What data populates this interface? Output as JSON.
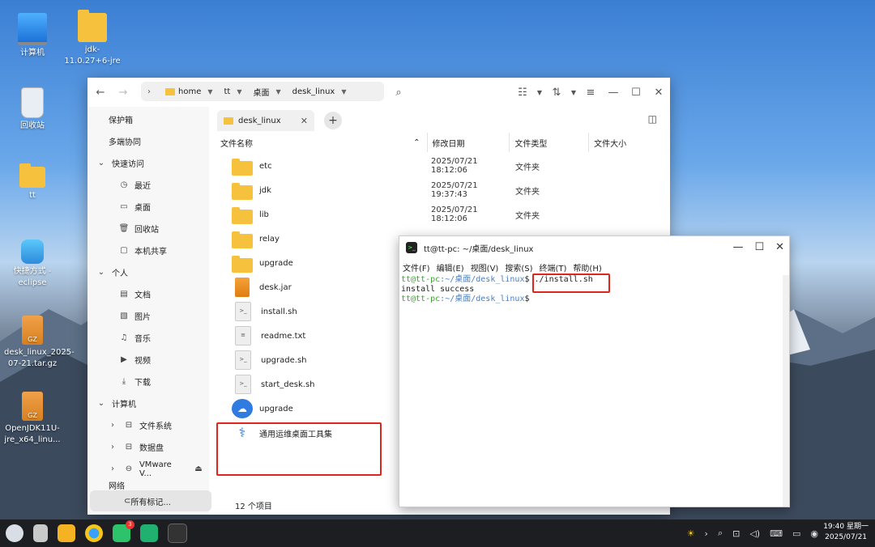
{
  "desktop": {
    "icons": [
      {
        "label": "计算机"
      },
      {
        "label": "jdk-11.0.27+6-jre"
      },
      {
        "label": "回收站"
      },
      {
        "label": "tt"
      },
      {
        "label": "快捷方式 - eclipse"
      },
      {
        "label": "desk_linux_2025-07-21.tar.gz"
      },
      {
        "label": "OpenJDK11U-jre_x64_linu..."
      }
    ],
    "gz_badge": "GZ"
  },
  "file_manager": {
    "breadcrumb": [
      "home",
      "tt",
      "桌面",
      "desk_linux"
    ],
    "sidebar": {
      "top": [
        "保护箱",
        "多端协同"
      ],
      "quick_access": {
        "label": "快速访问",
        "items": [
          "最近",
          "桌面",
          "回收站",
          "本机共享"
        ]
      },
      "personal": {
        "label": "个人",
        "items": [
          "文档",
          "图片",
          "音乐",
          "视频",
          "下载"
        ]
      },
      "computer": {
        "label": "计算机",
        "items": [
          "文件系统",
          "数据盘",
          "VMware V..."
        ]
      },
      "network_partial": "网络",
      "bottom": "所有标记..."
    },
    "tab": {
      "label": "desk_linux"
    },
    "columns": [
      "文件名称",
      "修改日期",
      "文件类型",
      "文件大小"
    ],
    "files": [
      {
        "name": "etc",
        "date": "2025/07/21 18:12:06",
        "type": "文件夹",
        "icon": "folder"
      },
      {
        "name": "jdk",
        "date": "2025/07/21 19:37:43",
        "type": "文件夹",
        "icon": "folder"
      },
      {
        "name": "lib",
        "date": "2025/07/21 18:12:06",
        "type": "文件夹",
        "icon": "folder"
      },
      {
        "name": "relay",
        "date": "",
        "type": "",
        "icon": "folder"
      },
      {
        "name": "upgrade",
        "date": "",
        "type": "",
        "icon": "folder"
      },
      {
        "name": "desk.jar",
        "date": "",
        "type": "",
        "icon": "jar"
      },
      {
        "name": "install.sh",
        "date": "",
        "type": "",
        "icon": "script"
      },
      {
        "name": "readme.txt",
        "date": "",
        "type": "",
        "icon": "text"
      },
      {
        "name": "upgrade.sh",
        "date": "",
        "type": "",
        "icon": "script"
      },
      {
        "name": "start_desk.sh",
        "date": "",
        "type": "",
        "icon": "script"
      },
      {
        "name": "upgrade",
        "date": "",
        "type": "",
        "icon": "cloud-app"
      },
      {
        "name": "通用运维桌面工具集",
        "date": "",
        "type": "",
        "icon": "tool-app"
      }
    ],
    "status": "12 个项目"
  },
  "terminal": {
    "title": "tt@tt-pc: ~/桌面/desk_linux",
    "menu": [
      "文件(F)",
      "编辑(E)",
      "视图(V)",
      "搜索(S)",
      "终端(T)",
      "帮助(H)"
    ],
    "lines": [
      {
        "user": "tt@tt-pc",
        "path": ":~/桌面/desk_linux",
        "prompt": "$",
        "cmd": " ./install.sh"
      },
      {
        "output": "install success"
      },
      {
        "user": "tt@tt-pc",
        "path": ":~/桌面/desk_linux",
        "prompt": "$",
        "cmd": ""
      }
    ]
  },
  "taskbar": {
    "badge": "3",
    "clock_time": "19:40 星期一",
    "clock_date": "2025/07/21"
  },
  "colors": {
    "highlight": "#e0261c",
    "accent": "#2f7be0",
    "folder": "#f6c23e"
  }
}
